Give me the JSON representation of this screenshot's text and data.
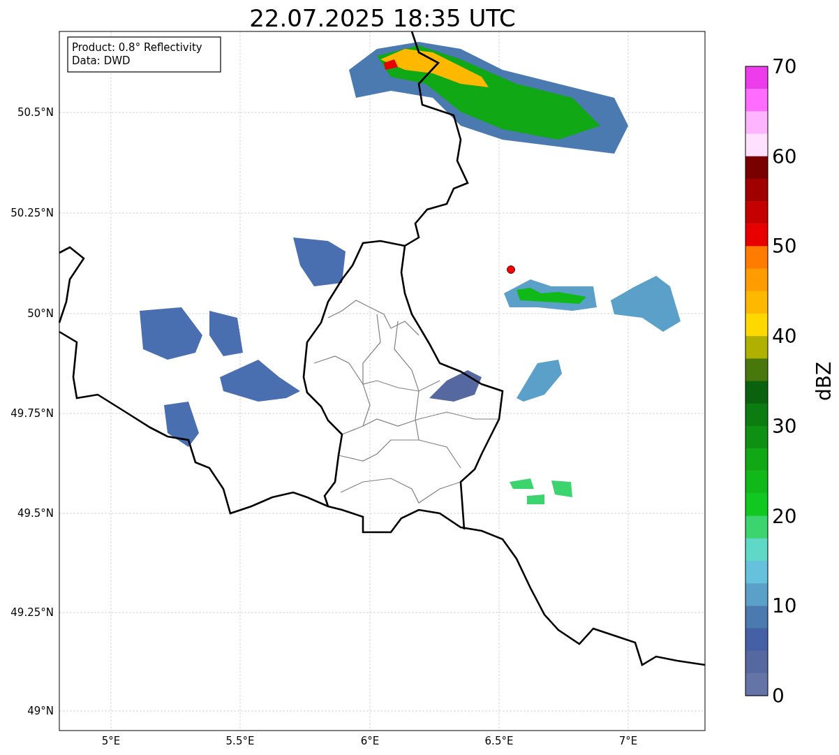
{
  "title": "22.07.2025 18:35 UTC",
  "info_box": [
    "Product: 0.8° Reflectivity",
    "Data: DWD"
  ],
  "x_ticks": [
    "5°E",
    "5.5°E",
    "6°E",
    "6.5°E",
    "7°E"
  ],
  "y_ticks": [
    "50.5°N",
    "50.25°N",
    "50°N",
    "49.75°N",
    "49.5°N",
    "49.25°N",
    "49°N"
  ],
  "colorbar": {
    "label": "dBZ",
    "ticks": [
      "70",
      "60",
      "50",
      "40",
      "30",
      "20",
      "10",
      "0"
    ],
    "segments": [
      {
        "color": "#ec3cec"
      },
      {
        "color": "#ff6cff"
      },
      {
        "color": "#ffb4ff"
      },
      {
        "color": "#ffe0ff"
      },
      {
        "color": "#7a0000"
      },
      {
        "color": "#a00000"
      },
      {
        "color": "#c40000"
      },
      {
        "color": "#e80000"
      },
      {
        "color": "#ff7c00"
      },
      {
        "color": "#ff9c00"
      },
      {
        "color": "#ffb800"
      },
      {
        "color": "#ffd800"
      },
      {
        "color": "#b0b000"
      },
      {
        "color": "#48780c"
      },
      {
        "color": "#0a620e"
      },
      {
        "color": "#0c7c10"
      },
      {
        "color": "#0e9012"
      },
      {
        "color": "#10a814"
      },
      {
        "color": "#10b818"
      },
      {
        "color": "#10c820"
      },
      {
        "color": "#3cd46e"
      },
      {
        "color": "#60d8c8"
      },
      {
        "color": "#66c2dc"
      },
      {
        "color": "#5aa0c8"
      },
      {
        "color": "#4a7ab0"
      },
      {
        "color": "#4560a4"
      },
      {
        "color": "#5568a0"
      },
      {
        "color": "#6474a6"
      }
    ]
  }
}
